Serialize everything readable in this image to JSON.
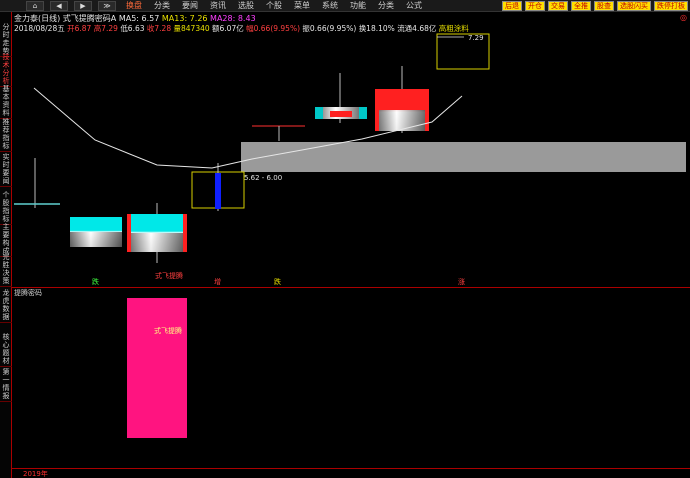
{
  "nav": {
    "home": "⌂",
    "back": "◀",
    "forward": "▶",
    "down": "▼",
    "menu_down": "≫"
  },
  "menu": [
    "换盘",
    "分类",
    "要闻",
    "资讯",
    "选股",
    "个股",
    "菜单",
    "系统",
    "功能",
    "分类",
    "公式"
  ],
  "right_buttons": [
    {
      "label": "后退",
      "bg": "#ffe000",
      "fg": "#c00000"
    },
    {
      "label": "开仓",
      "bg": "#ffe000",
      "fg": "#c00000"
    },
    {
      "label": "交易",
      "bg": "#ffe000",
      "fg": "#c00000"
    },
    {
      "label": "全推",
      "bg": "#ffe000",
      "fg": "#c00000"
    },
    {
      "label": "股查",
      "bg": "#ffe000",
      "fg": "#c00000"
    },
    {
      "label": "选股闪买",
      "bg": "#ffe000",
      "fg": "#c00000"
    },
    {
      "label": "跌停打板",
      "bg": "#ffe000",
      "fg": "#c00000"
    }
  ],
  "sidebar": [
    "分时走势",
    "技术分析",
    "基本资料",
    "推荐指标",
    "实时要闻",
    "个股指标",
    "主要构成",
    "完胜决策",
    "龙虎数据",
    "核心题材",
    "第一情报"
  ],
  "info": {
    "stock": "金力泰(日线)",
    "indicator": "式飞提腾密码A",
    "ma5": "MA5: 6.57",
    "ma13": "MA13: 7.26",
    "ma28": "MA28: 8.43",
    "line2_date": "2018/08/28五",
    "line2_open": "开6.87",
    "line2_high": "高7.29",
    "line2_low": "低6.63",
    "line2_close": "收7.28",
    "line2_vol": "量847340",
    "line2_amt": "额6.07亿",
    "line2_chg": "幅0.66(9.95%)",
    "line2_swing": "振0.66(9.95%)",
    "line2_turn": "换18.10%",
    "line2_float": "流通4.68亿",
    "line2_note": "高粗涂料"
  },
  "close_mark": "◎",
  "chart_data": {
    "type": "candlestick",
    "price_labels": {
      "high_marker": "7.29",
      "low_box": "5.62 - 6.00"
    },
    "bottom_signals": [
      "跌",
      "增",
      "跌",
      "涨"
    ],
    "annotation": "式飞提腾",
    "sub_title": "提腾密码",
    "sub_label": "式飞提腾"
  },
  "axis": {
    "year": "2019年"
  }
}
